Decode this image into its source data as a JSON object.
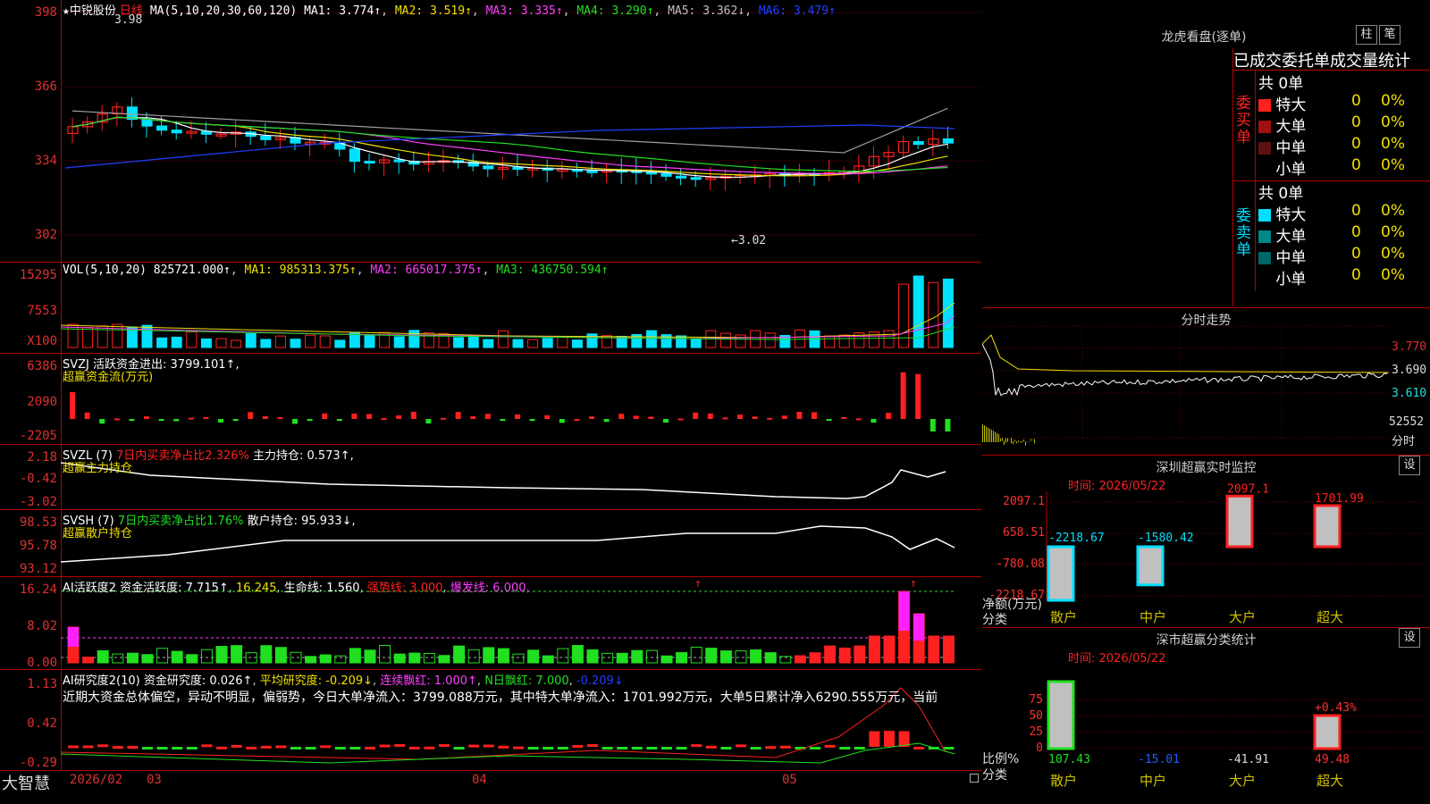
{
  "colors": {
    "up": "#ff2020",
    "down": "#00e0ff",
    "ma1": "#ffffff",
    "ma2": "#f0e000",
    "ma3": "#ff40ff",
    "ma4": "#20e020",
    "ma5": "#a0a0a0",
    "ma6": "#2040ff",
    "grid": "#b00000"
  },
  "header": {
    "star": "★",
    "stock_name": "中锐股份",
    "period": "日线",
    "ma_params": "MA(5,10,20,30,60,120)",
    "ma1": "MA1: 3.774↑",
    "ma2": "MA2: 3.519↑",
    "ma3": "MA3: 3.335↑",
    "ma4": "MA4: 3.290↑",
    "ma5": "MA5: 3.362↓",
    "ma6": "MA6: 3.479↑"
  },
  "price_panel": {
    "ticks": [
      "398",
      "366",
      "334",
      "302"
    ],
    "high_label": "3.98",
    "low_label": "←3.02"
  },
  "vol_panel": {
    "ticks": [
      "15295",
      "7553",
      "X100"
    ],
    "legend": "VOL(5,10,20)",
    "vol": "825721.000↑",
    "ma1": "MA1: 985313.375↑",
    "ma2": "MA2: 665017.375↑",
    "ma3": "MA3: 436750.594↑"
  },
  "svzj_panel": {
    "ticks": [
      "6386",
      "2090",
      "-2205"
    ],
    "legend": "SVZJ  活跃资金进出: 3799.101↑,",
    "sub": "超赢资金流(万元)"
  },
  "svzl_panel": {
    "ticks": [
      "2.18",
      "-0.42",
      "-3.02"
    ],
    "legend_a": "SVZL (7)",
    "legend_b": "7日内买卖净占比2.326%",
    "legend_c": "主力持仓: 0.573↑,",
    "sub": "超赢主力持仓"
  },
  "svsh_panel": {
    "ticks": [
      "98.53",
      "95.78",
      "93.12"
    ],
    "legend_a": "SVSH (7)",
    "legend_b": "7日内买卖净占比1.76%",
    "legend_c": "散户持仓: 95.933↓,",
    "sub": "超赢散户持仓"
  },
  "ai_panel": {
    "ticks": [
      "16.24",
      "8.02",
      "0.00"
    ],
    "legend_a": "AI活跃度2",
    "legend_b": "资金活跃度: 7.715↑",
    "legend_c": "16.245",
    "legend_d": "生命线: 1.560",
    "legend_e": "强势线: 3.000",
    "legend_f": "爆发线: 6.000,",
    "arrow": "↑"
  },
  "ai2_panel": {
    "ticks": [
      "1.13",
      "0.42",
      "-0.29"
    ],
    "legend_a": "AI研究度2(10)",
    "legend_b": "资金研究度: 0.026↑",
    "legend_c": "平均研究度: -0.209↓",
    "legend_d": "连续飘红: 1.000↑",
    "legend_e": "N日飘红: 7.000",
    "legend_f": "-0.209↓",
    "summary": "近期大资金总体偏空，异动不明显，偏弱势，今日大单净流入：3799.088万元，其中特大单净流入：1701.992万元，大单5日累计净入6290.555万元，当前"
  },
  "bottom_axis": {
    "logo": "大智慧",
    "d1": "2026/02",
    "d2": "03",
    "d3": "04",
    "d4": "05"
  },
  "lhb": {
    "title": "龙虎看盘(逐单)",
    "btn1": "柱",
    "btn2": "笔",
    "tab": "已成交委托单成交量统计",
    "buy_label": "委买单",
    "sell_label": "委卖单",
    "buy_total": "共 0单",
    "sell_total": "共 0单",
    "buy_rows": [
      {
        "name": "特大",
        "v": "0",
        "p": "0%",
        "c": "#ff2020"
      },
      {
        "name": "大单",
        "v": "0",
        "p": "0%",
        "c": "#a01010"
      },
      {
        "name": "中单",
        "v": "0",
        "p": "0%",
        "c": "#601010"
      },
      {
        "name": "小单",
        "v": "0",
        "p": "0%",
        "c": "#000000"
      }
    ],
    "sell_rows": [
      {
        "name": "特大",
        "v": "0",
        "p": "0%",
        "c": "#00e0ff"
      },
      {
        "name": "大单",
        "v": "0",
        "p": "0%",
        "c": "#008888"
      },
      {
        "name": "中单",
        "v": "0",
        "p": "0%",
        "c": "#006666"
      },
      {
        "name": "小单",
        "v": "0",
        "p": "0%",
        "c": "#000000"
      }
    ]
  },
  "intraday": {
    "title": "分时走势",
    "p1": "3.770",
    "p2": "3.690",
    "p3": "3.610",
    "vol": "52552",
    "unit": "分时"
  },
  "sz_monitor": {
    "title": "深圳超赢实时监控",
    "btn": "设",
    "time": "时间: 2026/05/22",
    "ticks": [
      "2097.1",
      "658.51",
      "-780.08",
      "-2218.67"
    ],
    "ylabel": "净额(万元)",
    "xlabel": "分类",
    "cats": [
      "散户",
      "中户",
      "大户",
      "超大"
    ],
    "values": [
      -2218.67,
      -1580.42,
      2097.1,
      1701.99
    ],
    "labels": [
      "-2218.67",
      "-1580.42",
      "2097.1",
      "1701.99"
    ]
  },
  "sz_class": {
    "title": "深市超赢分类统计",
    "btn": "设",
    "time": "时间: 2026/05/22",
    "ticks": [
      "75",
      "50",
      "25",
      "0"
    ],
    "ylabel": "比例%",
    "xlabel": "分类",
    "cats": [
      "散户",
      "中户",
      "大户",
      "超大"
    ],
    "values": [
      107.43,
      -15.01,
      -41.91,
      49.48
    ],
    "labels": [
      "107.43",
      "-15.01",
      "-41.91",
      "49.48"
    ],
    "note": "+0.43%"
  }
}
